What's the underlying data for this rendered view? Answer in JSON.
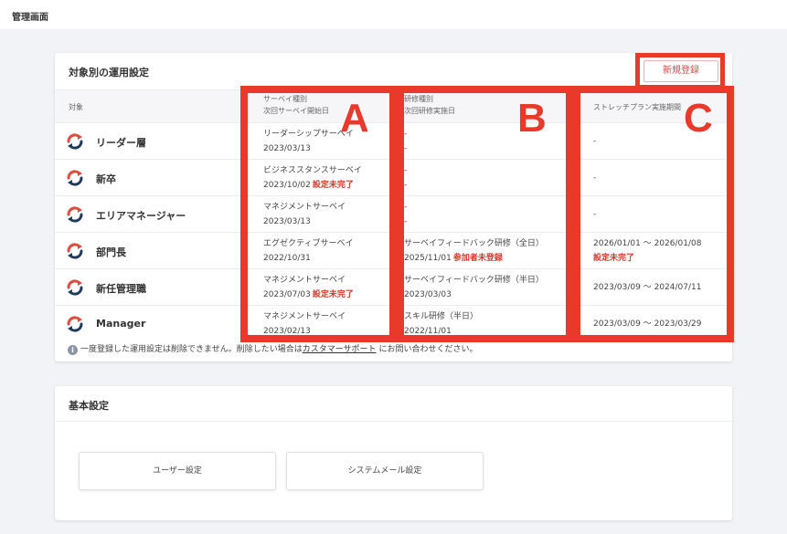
{
  "header": {
    "title": "管理画面"
  },
  "operations": {
    "title": "対象別の運用設定",
    "new_button_label": "新規登録",
    "columns": {
      "target": "対象",
      "survey_line1": "サーベイ種別",
      "survey_line2": "次回サーベイ開始日",
      "training_line1": "研修種別",
      "training_line2": "次回研修実施日",
      "stretch": "ストレッチプラン実施期間"
    },
    "rows": [
      {
        "label": "リーダー層",
        "survey_name": "リーダーシップサーベイ",
        "survey_date": "2023/03/13",
        "survey_status": "",
        "training_name": "-",
        "training_date": "-",
        "training_status": "",
        "stretch_period": "-",
        "stretch_status": ""
      },
      {
        "label": "新卒",
        "survey_name": "ビジネススタンスサーベイ",
        "survey_date": "2023/10/02",
        "survey_status": "設定未完了",
        "training_name": "-",
        "training_date": "-",
        "training_status": "",
        "stretch_period": "-",
        "stretch_status": ""
      },
      {
        "label": "エリアマネージャー",
        "survey_name": "マネジメントサーベイ",
        "survey_date": "2023/03/13",
        "survey_status": "",
        "training_name": "-",
        "training_date": "-",
        "training_status": "",
        "stretch_period": "-",
        "stretch_status": ""
      },
      {
        "label": "部門長",
        "survey_name": "エグゼクティブサーベイ",
        "survey_date": "2022/10/31",
        "survey_status": "",
        "training_name": "サーベイフィードバック研修（全日）",
        "training_date": "2025/11/01",
        "training_status": "参加者未登録",
        "stretch_period": "2026/01/01 ～ 2026/01/08",
        "stretch_status": "設定未完了"
      },
      {
        "label": "新任管理職",
        "survey_name": "マネジメントサーベイ",
        "survey_date": "2023/07/03",
        "survey_status": "設定未完了",
        "training_name": "サーベイフィードバック研修（半日）",
        "training_date": "2023/03/03",
        "training_status": "",
        "stretch_period": "2023/03/09 ～ 2024/07/11",
        "stretch_status": ""
      },
      {
        "label": "Manager",
        "survey_name": "マネジメントサーベイ",
        "survey_date": "2023/02/13",
        "survey_status": "",
        "training_name": "スキル研修（半日）",
        "training_date": "2022/11/01",
        "training_status": "",
        "stretch_period": "2023/03/09 ～ 2023/03/29",
        "stretch_status": ""
      }
    ],
    "note_icon": "i",
    "note_prefix": "一度登録した運用設定は削除できません。削除したい場合は",
    "note_link": "カスタマーサポート",
    "note_suffix": "にお問い合わせください。"
  },
  "annotations": {
    "a": "A",
    "b": "B",
    "c": "C"
  },
  "basic_settings": {
    "title": "基本設定",
    "user_settings_label": "ユーザー設定",
    "system_mail_label": "システムメール設定"
  },
  "colors": {
    "highlight": "#e8392a",
    "warning": "#d33b2c",
    "icon_red": "#e04a3a",
    "icon_navy": "#1f3a5a"
  }
}
